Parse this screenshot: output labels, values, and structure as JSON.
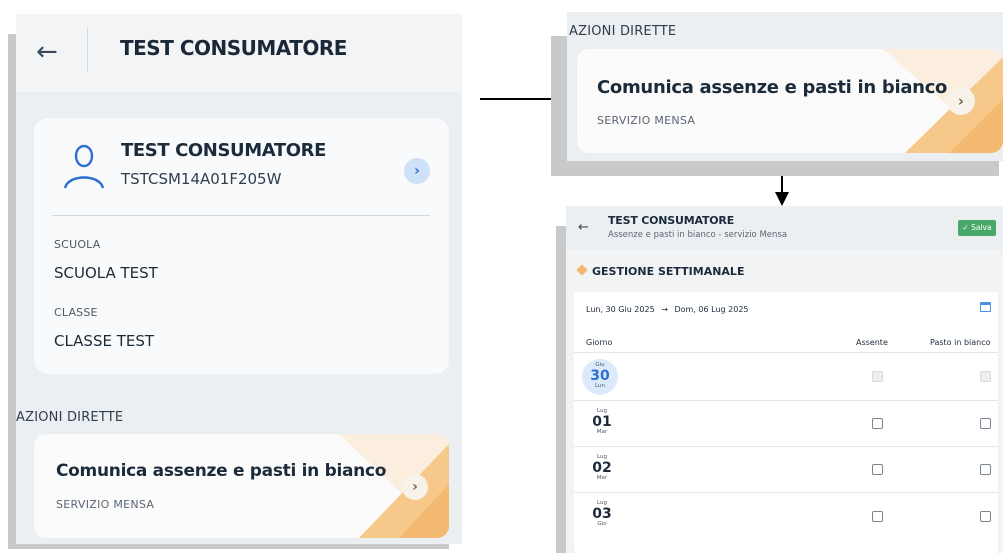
{
  "left_panel": {
    "title": "TEST CONSUMATORE",
    "profile": {
      "name": "TEST CONSUMATORE",
      "code": "TSTCSM14A01F205W",
      "scuola_label": "SCUOLA",
      "scuola_value": "SCUOLA TEST",
      "classe_label": "CLASSE",
      "classe_value": "CLASSE TEST"
    },
    "section_title": "AZIONI DIRETTE",
    "action": {
      "title": "Comunica assenze e pasti in bianco",
      "subtitle": "SERVIZIO MENSA"
    }
  },
  "top_right_panel": {
    "section_title": "AZIONI DIRETTE",
    "action": {
      "title": "Comunica assenze e pasti in bianco",
      "subtitle": "SERVIZIO MENSA"
    }
  },
  "bottom_right_panel": {
    "title": "TEST CONSUMATORE",
    "subtitle": "Assenze e pasti in bianco - servizio Mensa",
    "save_label": "✓ Salva",
    "section_title": "GESTIONE SETTIMANALE",
    "range_start": "Lun, 30 Giu 2025",
    "range_arrow": "→",
    "range_end": "Dom, 06 Lug 2025",
    "columns": {
      "day": "Giorno",
      "absent": "Assente",
      "white_meal": "Pasto in bianco"
    },
    "rows": [
      {
        "month": "Giu",
        "day": "30",
        "weekday": "Lun",
        "selected": true,
        "disabled": true
      },
      {
        "month": "Lug",
        "day": "01",
        "weekday": "Mar",
        "selected": false,
        "disabled": false
      },
      {
        "month": "Lug",
        "day": "02",
        "weekday": "Mer",
        "selected": false,
        "disabled": false
      },
      {
        "month": "Lug",
        "day": "03",
        "weekday": "Gio",
        "selected": false,
        "disabled": false
      }
    ]
  },
  "colors": {
    "accent_blue": "#2a6fd1",
    "save_green": "#48a868",
    "orange_accent": "#f2b770"
  }
}
